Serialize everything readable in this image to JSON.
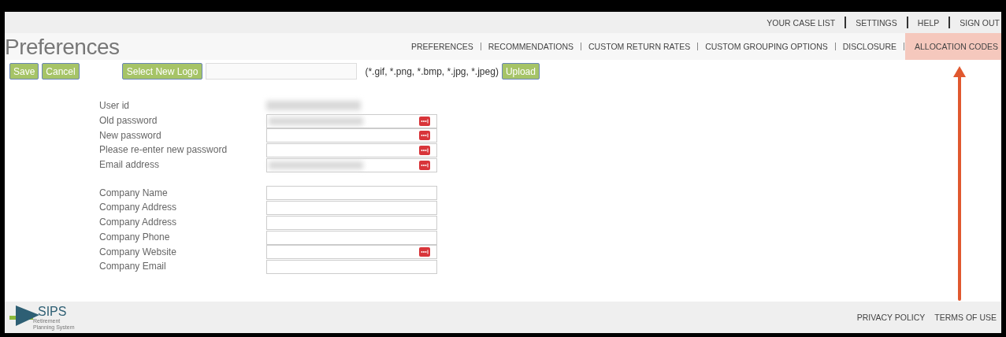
{
  "top_links": [
    "YOUR CASE LIST",
    "SETTINGS",
    "HELP",
    "SIGN OUT"
  ],
  "title": "Preferences",
  "nav": [
    {
      "label": "PREFERENCES",
      "highlighted": false
    },
    {
      "label": "RECOMMENDATIONS",
      "highlighted": false
    },
    {
      "label": "CUSTOM RETURN RATES",
      "highlighted": false
    },
    {
      "label": "CUSTOM GROUPING OPTIONS",
      "highlighted": false
    },
    {
      "label": "DISCLOSURE",
      "highlighted": false
    },
    {
      "label": "ALLOCATION CODES",
      "highlighted": true
    }
  ],
  "toolbar": {
    "save": "Save",
    "cancel": "Cancel",
    "select_logo": "Select New Logo",
    "file_hint": "(*.gif, *.png, *.bmp, *.jpg, *.jpeg)",
    "upload": "Upload"
  },
  "fields": [
    {
      "label": "User id",
      "kind": "readonly",
      "blurred": true,
      "key_icon": false
    },
    {
      "label": "Old password",
      "kind": "input",
      "blurred": true,
      "key_icon": true
    },
    {
      "label": "New password",
      "kind": "input",
      "blurred": false,
      "key_icon": true
    },
    {
      "label": "Please re-enter new password",
      "kind": "input",
      "blurred": false,
      "key_icon": true
    },
    {
      "label": "Email address",
      "kind": "input",
      "blurred": true,
      "key_icon": true
    },
    {
      "kind": "gap"
    },
    {
      "label": "Company Name",
      "kind": "input",
      "blurred": false,
      "key_icon": false
    },
    {
      "label": "Company Address",
      "kind": "input",
      "blurred": false,
      "key_icon": false
    },
    {
      "label": "Company Address",
      "kind": "input",
      "blurred": false,
      "key_icon": false
    },
    {
      "label": "Company Phone",
      "kind": "input",
      "blurred": false,
      "key_icon": false
    },
    {
      "label": "Company Website",
      "kind": "input",
      "blurred": false,
      "key_icon": true
    },
    {
      "label": "Company Email",
      "kind": "input",
      "blurred": false,
      "key_icon": false
    }
  ],
  "footer": {
    "logo_name": "SIPS",
    "logo_tagline": "Retirement Planning System",
    "links": [
      "PRIVACY POLICY",
      "TERMS OF USE"
    ]
  }
}
